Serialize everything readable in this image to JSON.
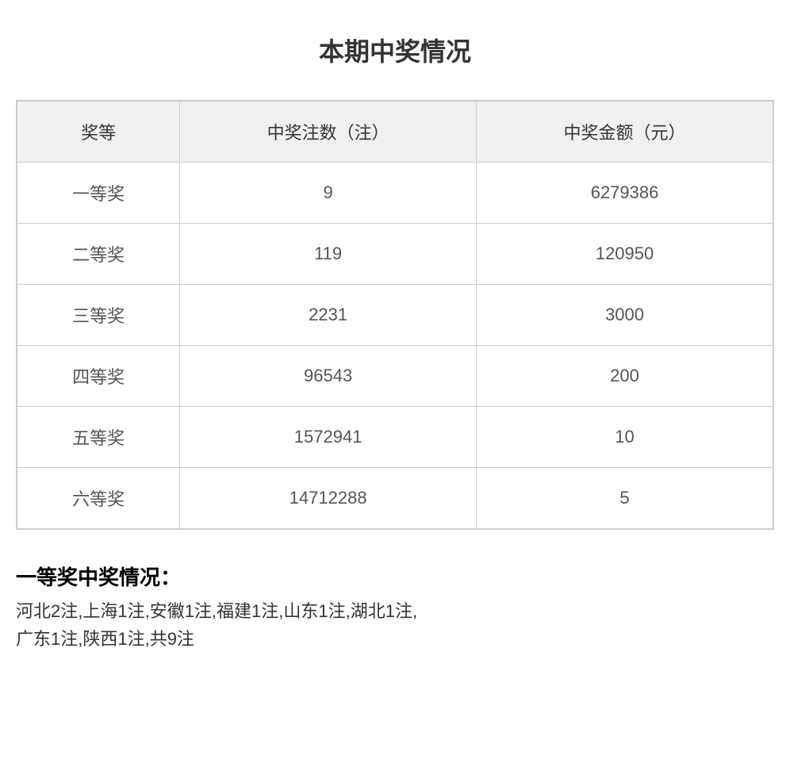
{
  "page": {
    "title": "本期中奖情况"
  },
  "table": {
    "headers": {
      "prize_level": "奖等",
      "count": "中奖注数（注）",
      "amount": "中奖金额（元）"
    },
    "rows": [
      {
        "level": "一等奖",
        "count": "9",
        "amount": "6279386"
      },
      {
        "level": "二等奖",
        "count": "119",
        "amount": "120950"
      },
      {
        "level": "三等奖",
        "count": "2231",
        "amount": "3000"
      },
      {
        "level": "四等奖",
        "count": "96543",
        "amount": "200"
      },
      {
        "level": "五等奖",
        "count": "1572941",
        "amount": "10"
      },
      {
        "level": "六等奖",
        "count": "14712288",
        "amount": "5"
      }
    ]
  },
  "first_prize_section": {
    "title": "一等奖中奖情况：",
    "description_line1": "河北2注,上海1注,安徽1注,福建1注,山东1注,湖北1注,",
    "description_line2": "广东1注,陕西1注,共9注"
  }
}
